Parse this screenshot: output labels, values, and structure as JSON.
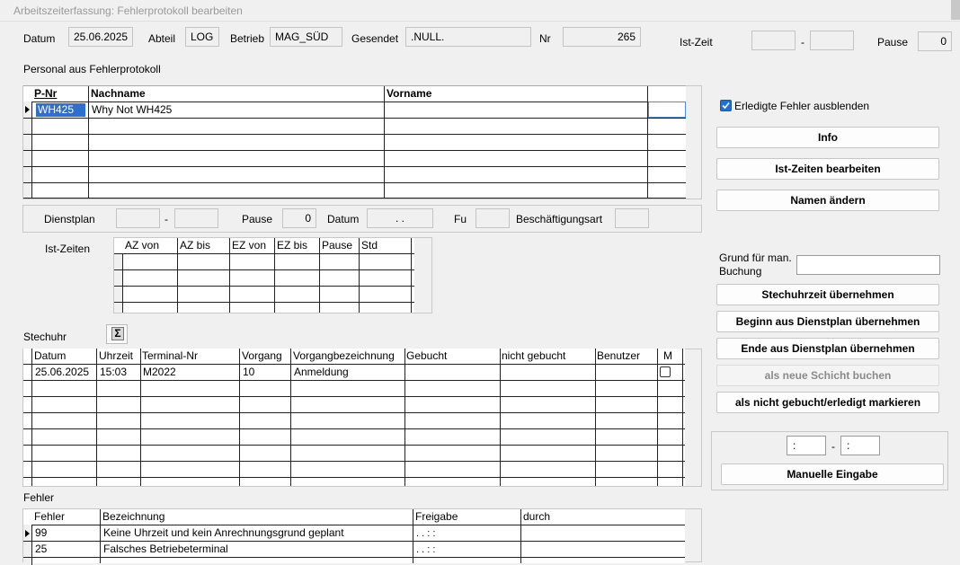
{
  "window": {
    "title": "Arbeitszeiterfassung: Fehlerprotokoll bearbeiten"
  },
  "header": {
    "datum_label": "Datum",
    "datum": "25.06.2025",
    "abteil_label": "Abteil",
    "abteil": "LOG",
    "betrieb_label": "Betrieb",
    "betrieb": "MAG_SÜD",
    "gesendet_label": "Gesendet",
    "gesendet": ".NULL.",
    "nr_label": "Nr",
    "nr": "265",
    "istzeit_label": "Ist-Zeit",
    "istzeit_von": "",
    "istzeit_bis": "",
    "dash": "-",
    "pause_label": "Pause",
    "pause": "0"
  },
  "personal": {
    "section_label": "Personal aus Fehlerprotokoll",
    "columns": [
      "P-Nr",
      "Nachname",
      "Vorname"
    ],
    "rows": [
      [
        "WH425",
        "Why Not WH425",
        ""
      ]
    ]
  },
  "details": {
    "dienstplan_label": "Dienstplan",
    "dienstplan_von": "",
    "dienstplan_bis": "",
    "dash": "-",
    "pause_label": "Pause",
    "pause": "0",
    "datum_label": "Datum",
    "datum": ". .",
    "fu_label": "Fu",
    "fu": "",
    "art_label": "Beschäftigungsart",
    "art": ""
  },
  "istzeiten": {
    "label": "Ist-Zeiten",
    "columns": [
      "AZ von",
      "AZ bis",
      "EZ von",
      "EZ bis",
      "Pause",
      "Std"
    ]
  },
  "stechuhr": {
    "label": "Stechuhr",
    "sum_icon": "Σ",
    "columns": [
      "Datum",
      "Uhrzeit",
      "Terminal-Nr",
      "Vorgang",
      "Vorgangbezeichnung",
      "Gebucht",
      "nicht gebucht",
      "Benutzer",
      "M"
    ],
    "rows": [
      [
        "25.06.2025",
        "15:03",
        "M2022",
        "10",
        "Anmeldung",
        "",
        "",
        "",
        ""
      ]
    ]
  },
  "fehler": {
    "label": "Fehler",
    "columns": [
      "Fehler",
      "Bezeichnung",
      "Freigabe",
      "durch"
    ],
    "rows": [
      [
        "99",
        "Keine Uhrzeit und kein Anrechnungsgrund geplant",
        ". .     : :",
        ""
      ],
      [
        "25",
        "Falsches Betriebeterminal",
        ". .     : :",
        ""
      ]
    ]
  },
  "right": {
    "erledigte_label": "Erledigte Fehler ausblenden",
    "erledigte_checked": true,
    "info": "Info",
    "ist_zeiten_bearbeiten": "Ist-Zeiten bearbeiten",
    "namen_aendern": "Namen ändern",
    "grund_label": "Grund für man. Buchung",
    "grund_value": "",
    "stechuhrzeit": "Stechuhrzeit übernehmen",
    "beginn": "Beginn aus Dienstplan übernehmen",
    "ende": "Ende aus Dienstplan übernehmen",
    "neue_schicht": "als neue Schicht buchen",
    "nicht_gebucht": "als nicht gebucht/erledigt markieren",
    "manuell_von": " :",
    "manuell_bis": " :",
    "dash": "-",
    "manuelle_eingabe": "Manuelle Eingabe"
  }
}
